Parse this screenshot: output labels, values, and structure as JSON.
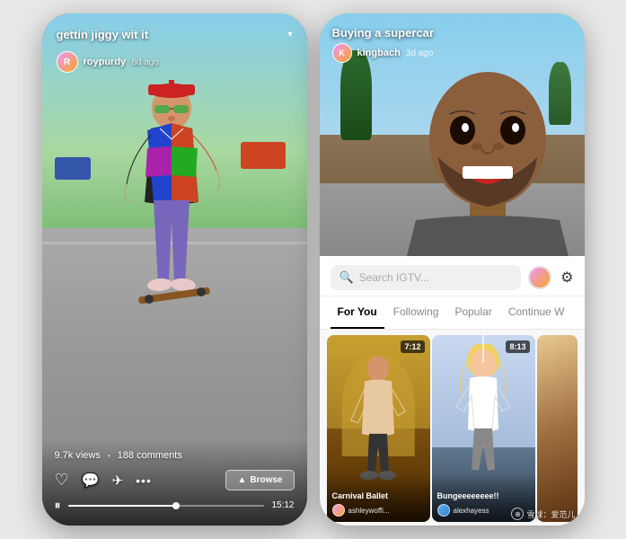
{
  "left_phone": {
    "video_title": "gettin jiggy wit it",
    "username": "roypurdy",
    "time_ago": "6d ago",
    "views": "9.7k views",
    "comments": "188 comments",
    "duration": "15:12",
    "progress_percent": 55,
    "browse_label": "Browse"
  },
  "right_phone": {
    "video_title": "Buying a supercar",
    "username": "kingbach",
    "time_ago": "3d ago",
    "search_placeholder": "Search IGTV...",
    "tabs": [
      {
        "label": "For You",
        "active": true
      },
      {
        "label": "Following",
        "active": false
      },
      {
        "label": "Popular",
        "active": false
      },
      {
        "label": "Continue W",
        "active": false
      }
    ],
    "thumbnails": [
      {
        "title": "Carnival Ballet",
        "username": "ashleywoffi...",
        "duration": "7:12",
        "bg_class": "thumb-bg-1"
      },
      {
        "title": "Bungeeeeeeee!!",
        "username": "alexhayess",
        "duration": "8:13",
        "bg_class": "thumb-bg-2"
      },
      {
        "title": "",
        "username": "",
        "duration": "",
        "bg_class": "thumb-bg-3"
      }
    ]
  },
  "watermark": {
    "icon": "⊕",
    "text": "雪球：爱范儿"
  },
  "icons": {
    "heart": "♡",
    "comment": "💬",
    "send": "✈",
    "more": "•••",
    "pause": "⏸",
    "browse_arrow": "▲",
    "dropdown": "▾",
    "search": "🔍",
    "settings": "⚙"
  }
}
